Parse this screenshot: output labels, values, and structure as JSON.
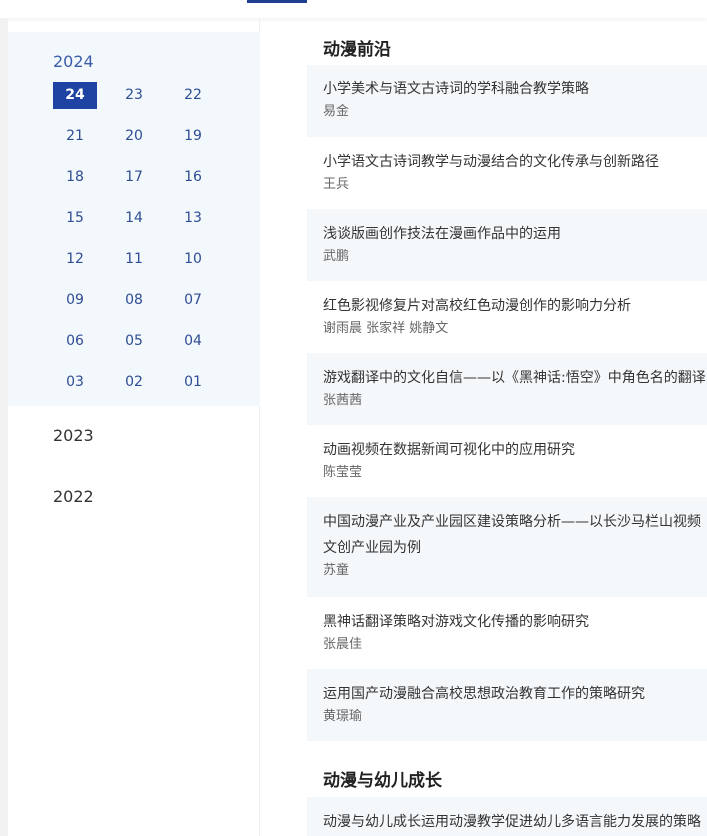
{
  "sidebar": {
    "years": [
      {
        "label": "2024",
        "issues": [
          "24",
          "23",
          "22",
          "21",
          "20",
          "19",
          "18",
          "17",
          "16",
          "15",
          "14",
          "13",
          "12",
          "11",
          "10",
          "09",
          "08",
          "07",
          "06",
          "05",
          "04",
          "03",
          "02",
          "01"
        ],
        "selected_issue": "24"
      },
      {
        "label": "2023"
      },
      {
        "label": "2022"
      }
    ]
  },
  "sections": [
    {
      "title": "动漫前沿",
      "articles": [
        {
          "title": "小学美术与语文古诗词的学科融合教学策略",
          "authors": "易金"
        },
        {
          "title": "小学语文古诗词教学与动漫结合的文化传承与创新路径",
          "authors": "王兵"
        },
        {
          "title": "浅谈版画创作技法在漫画作品中的运用",
          "authors": "武鹏"
        },
        {
          "title": "红色影视修复片对高校红色动漫创作的影响力分析",
          "authors": "谢雨晨 张家祥 姚静文"
        },
        {
          "title": "游戏翻译中的文化自信——以《黑神话:悟空》中角色名的翻译",
          "authors": "张茜茜"
        },
        {
          "title": "动画视频在数据新闻可视化中的应用研究",
          "authors": "陈莹莹"
        },
        {
          "title": "中国动漫产业及产业园区建设策略分析——以长沙马栏山视频文创产业园为例",
          "authors": "苏童"
        },
        {
          "title": "黑神话翻译策略对游戏文化传播的影响研究",
          "authors": "张晨佳"
        },
        {
          "title": "运用国产动漫融合高校思想政治教育工作的策略研究",
          "authors": "黄璟瑜"
        }
      ]
    },
    {
      "title": "动漫与幼儿成长",
      "articles": [
        {
          "title": "动漫与幼儿成长运用动漫教学促进幼儿多语言能力发展的策略",
          "authors": ""
        }
      ]
    }
  ]
}
